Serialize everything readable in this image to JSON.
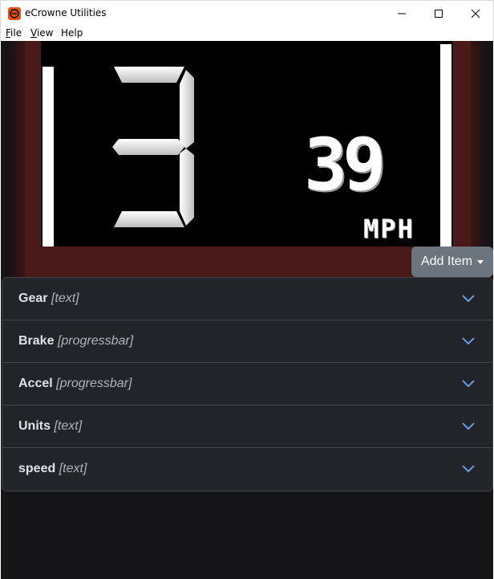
{
  "window": {
    "title": "eCrowne Utilities",
    "icon": "app-logo-icon",
    "controls": [
      "minimize-icon",
      "maximize-icon",
      "close-icon"
    ]
  },
  "menu": {
    "file_ul": "F",
    "file_rest": "ile",
    "view_ul": "V",
    "view_rest": "iew",
    "help": "Help"
  },
  "dashboard": {
    "gear": "3",
    "speed": "39",
    "units": "MPH",
    "background_color": "#000000",
    "glow_color": "#4a1a1a"
  },
  "add_item": {
    "label": "Add Item",
    "icon": "caret-down-icon",
    "color": "#6c757d"
  },
  "items": [
    {
      "name": "Gear",
      "type": "[text]"
    },
    {
      "name": "Brake",
      "type": "[progressbar]"
    },
    {
      "name": "Accel",
      "type": "[progressbar]"
    },
    {
      "name": "Units",
      "type": "[text]"
    },
    {
      "name": "speed",
      "type": "[text]"
    }
  ],
  "accent_color": "#6ea8fe"
}
